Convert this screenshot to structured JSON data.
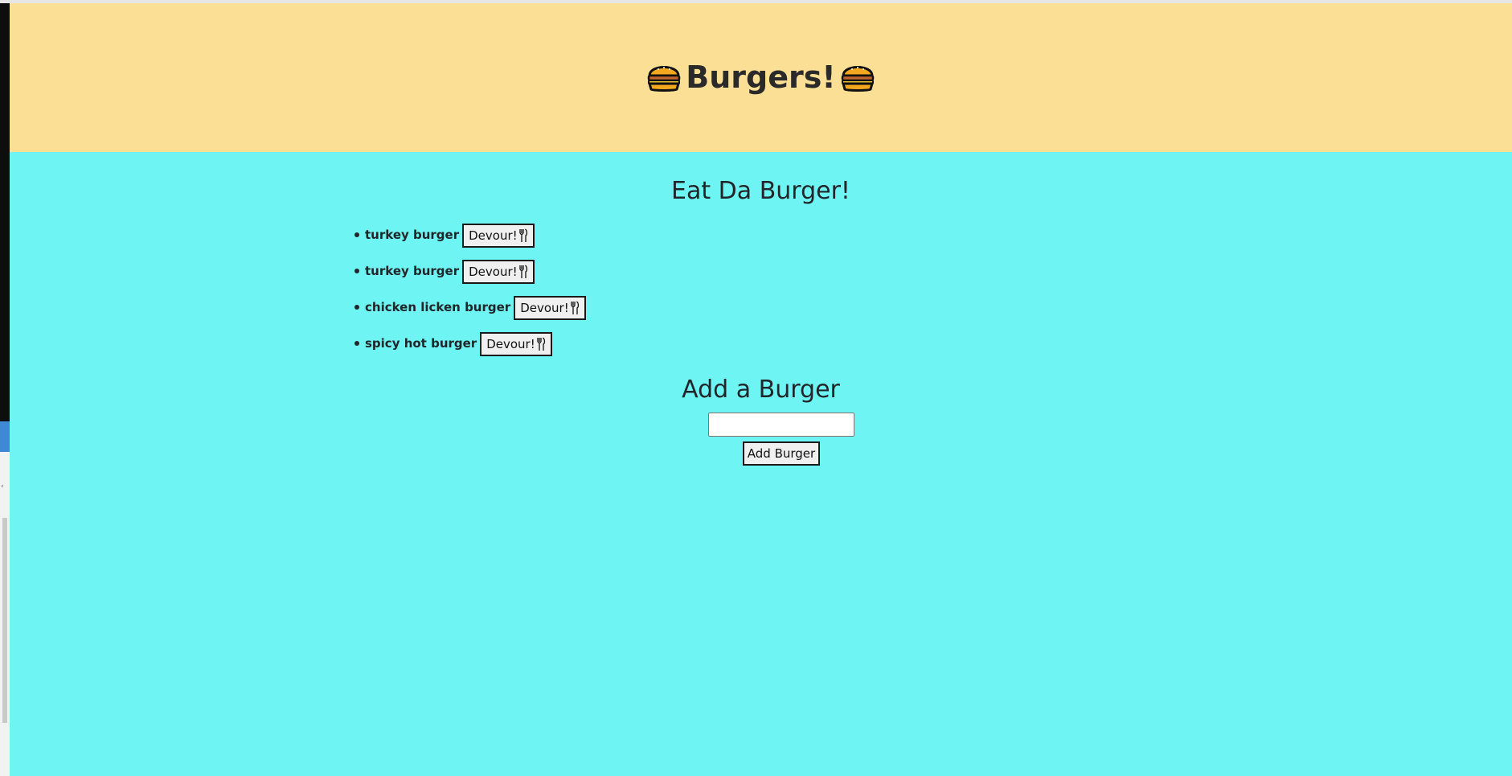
{
  "header": {
    "title": "Burgers!",
    "icon": "burger-icon"
  },
  "eat_section": {
    "title": "Eat Da Burger!",
    "burgers": [
      {
        "name": "turkey burger",
        "button_label": "Devour!",
        "button_icon": "fork-knife-icon"
      },
      {
        "name": "turkey burger",
        "button_label": "Devour!",
        "button_icon": "fork-knife-icon"
      },
      {
        "name": "chicken licken burger",
        "button_label": "Devour!",
        "button_icon": "fork-knife-icon"
      },
      {
        "name": "spicy hot burger",
        "button_label": "Devour!",
        "button_icon": "fork-knife-icon"
      }
    ]
  },
  "add_section": {
    "title": "Add a Burger",
    "input_value": "",
    "input_placeholder": "",
    "button_label": "Add Burger"
  },
  "colors": {
    "header_bg": "#fbdf94",
    "page_bg": "#6ef5f3",
    "text": "#212529"
  }
}
